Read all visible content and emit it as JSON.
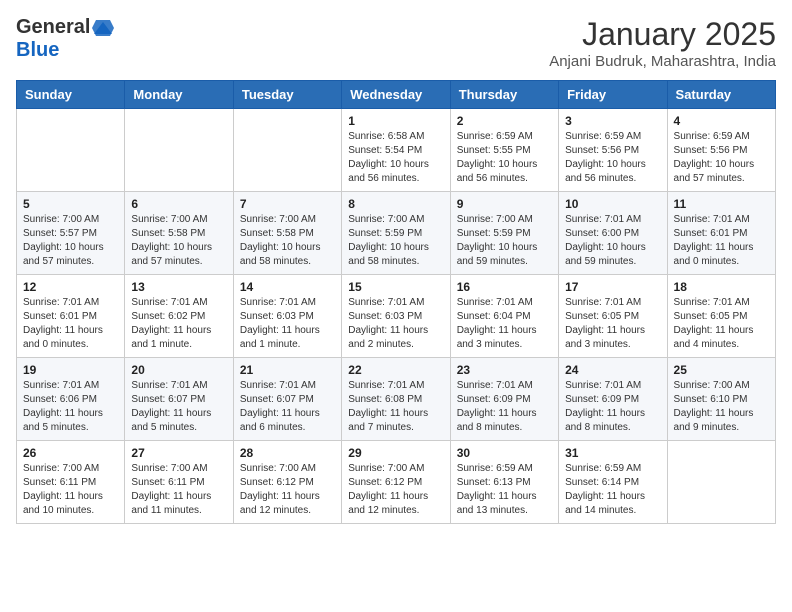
{
  "header": {
    "logo_general": "General",
    "logo_blue": "Blue",
    "title": "January 2025",
    "location": "Anjani Budruk, Maharashtra, India"
  },
  "weekdays": [
    "Sunday",
    "Monday",
    "Tuesday",
    "Wednesday",
    "Thursday",
    "Friday",
    "Saturday"
  ],
  "weeks": [
    [
      {
        "day": "",
        "info": ""
      },
      {
        "day": "",
        "info": ""
      },
      {
        "day": "",
        "info": ""
      },
      {
        "day": "1",
        "info": "Sunrise: 6:58 AM\nSunset: 5:54 PM\nDaylight: 10 hours\nand 56 minutes."
      },
      {
        "day": "2",
        "info": "Sunrise: 6:59 AM\nSunset: 5:55 PM\nDaylight: 10 hours\nand 56 minutes."
      },
      {
        "day": "3",
        "info": "Sunrise: 6:59 AM\nSunset: 5:56 PM\nDaylight: 10 hours\nand 56 minutes."
      },
      {
        "day": "4",
        "info": "Sunrise: 6:59 AM\nSunset: 5:56 PM\nDaylight: 10 hours\nand 57 minutes."
      }
    ],
    [
      {
        "day": "5",
        "info": "Sunrise: 7:00 AM\nSunset: 5:57 PM\nDaylight: 10 hours\nand 57 minutes."
      },
      {
        "day": "6",
        "info": "Sunrise: 7:00 AM\nSunset: 5:58 PM\nDaylight: 10 hours\nand 57 minutes."
      },
      {
        "day": "7",
        "info": "Sunrise: 7:00 AM\nSunset: 5:58 PM\nDaylight: 10 hours\nand 58 minutes."
      },
      {
        "day": "8",
        "info": "Sunrise: 7:00 AM\nSunset: 5:59 PM\nDaylight: 10 hours\nand 58 minutes."
      },
      {
        "day": "9",
        "info": "Sunrise: 7:00 AM\nSunset: 5:59 PM\nDaylight: 10 hours\nand 59 minutes."
      },
      {
        "day": "10",
        "info": "Sunrise: 7:01 AM\nSunset: 6:00 PM\nDaylight: 10 hours\nand 59 minutes."
      },
      {
        "day": "11",
        "info": "Sunrise: 7:01 AM\nSunset: 6:01 PM\nDaylight: 11 hours\nand 0 minutes."
      }
    ],
    [
      {
        "day": "12",
        "info": "Sunrise: 7:01 AM\nSunset: 6:01 PM\nDaylight: 11 hours\nand 0 minutes."
      },
      {
        "day": "13",
        "info": "Sunrise: 7:01 AM\nSunset: 6:02 PM\nDaylight: 11 hours\nand 1 minute."
      },
      {
        "day": "14",
        "info": "Sunrise: 7:01 AM\nSunset: 6:03 PM\nDaylight: 11 hours\nand 1 minute."
      },
      {
        "day": "15",
        "info": "Sunrise: 7:01 AM\nSunset: 6:03 PM\nDaylight: 11 hours\nand 2 minutes."
      },
      {
        "day": "16",
        "info": "Sunrise: 7:01 AM\nSunset: 6:04 PM\nDaylight: 11 hours\nand 3 minutes."
      },
      {
        "day": "17",
        "info": "Sunrise: 7:01 AM\nSunset: 6:05 PM\nDaylight: 11 hours\nand 3 minutes."
      },
      {
        "day": "18",
        "info": "Sunrise: 7:01 AM\nSunset: 6:05 PM\nDaylight: 11 hours\nand 4 minutes."
      }
    ],
    [
      {
        "day": "19",
        "info": "Sunrise: 7:01 AM\nSunset: 6:06 PM\nDaylight: 11 hours\nand 5 minutes."
      },
      {
        "day": "20",
        "info": "Sunrise: 7:01 AM\nSunset: 6:07 PM\nDaylight: 11 hours\nand 5 minutes."
      },
      {
        "day": "21",
        "info": "Sunrise: 7:01 AM\nSunset: 6:07 PM\nDaylight: 11 hours\nand 6 minutes."
      },
      {
        "day": "22",
        "info": "Sunrise: 7:01 AM\nSunset: 6:08 PM\nDaylight: 11 hours\nand 7 minutes."
      },
      {
        "day": "23",
        "info": "Sunrise: 7:01 AM\nSunset: 6:09 PM\nDaylight: 11 hours\nand 8 minutes."
      },
      {
        "day": "24",
        "info": "Sunrise: 7:01 AM\nSunset: 6:09 PM\nDaylight: 11 hours\nand 8 minutes."
      },
      {
        "day": "25",
        "info": "Sunrise: 7:00 AM\nSunset: 6:10 PM\nDaylight: 11 hours\nand 9 minutes."
      }
    ],
    [
      {
        "day": "26",
        "info": "Sunrise: 7:00 AM\nSunset: 6:11 PM\nDaylight: 11 hours\nand 10 minutes."
      },
      {
        "day": "27",
        "info": "Sunrise: 7:00 AM\nSunset: 6:11 PM\nDaylight: 11 hours\nand 11 minutes."
      },
      {
        "day": "28",
        "info": "Sunrise: 7:00 AM\nSunset: 6:12 PM\nDaylight: 11 hours\nand 12 minutes."
      },
      {
        "day": "29",
        "info": "Sunrise: 7:00 AM\nSunset: 6:12 PM\nDaylight: 11 hours\nand 12 minutes."
      },
      {
        "day": "30",
        "info": "Sunrise: 6:59 AM\nSunset: 6:13 PM\nDaylight: 11 hours\nand 13 minutes."
      },
      {
        "day": "31",
        "info": "Sunrise: 6:59 AM\nSunset: 6:14 PM\nDaylight: 11 hours\nand 14 minutes."
      },
      {
        "day": "",
        "info": ""
      }
    ]
  ]
}
